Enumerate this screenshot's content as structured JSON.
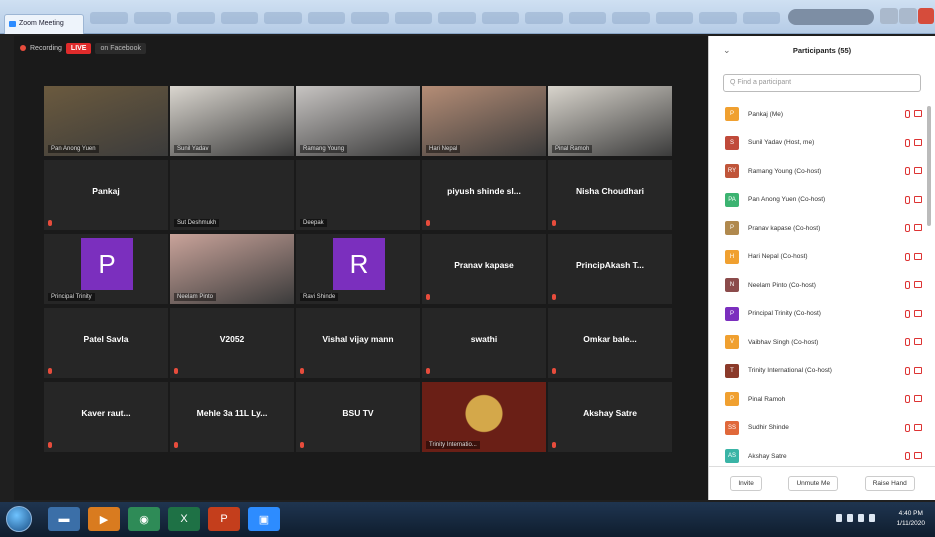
{
  "window": {
    "tab_title": "Zoom Meeting"
  },
  "meeting": {
    "recording_label": "Recording",
    "live_label": "LIVE",
    "view_label": "on Facebook",
    "tiles": [
      [
        {
          "kind": "video",
          "caption": "Pan Anong Yuen",
          "photo_color": "#6b5a3e",
          "active": true
        },
        {
          "kind": "video",
          "caption": "Sunil Yadav",
          "photo_color": "#dad6cf"
        },
        {
          "kind": "video",
          "caption": "Ramang Young",
          "photo_color": "#c7c4c2"
        },
        {
          "kind": "video",
          "caption": "Hari Nepal",
          "photo_color": "#b58d76"
        },
        {
          "kind": "video",
          "caption": "Pinal Ramoh",
          "photo_color": "#d8d4cc"
        }
      ],
      [
        {
          "kind": "name",
          "name": "Pankaj"
        },
        {
          "kind": "blank",
          "caption": "Sut Deshmukh"
        },
        {
          "kind": "blank",
          "caption": "Deepak"
        },
        {
          "kind": "name",
          "name": "piyush shinde sl..."
        },
        {
          "kind": "name",
          "name": "Nisha Choudhari"
        }
      ],
      [
        {
          "kind": "letter",
          "letter": "P",
          "caption": "Principal Trinity"
        },
        {
          "kind": "video",
          "caption": "Neelam Pinto",
          "photo_color": "#c9a39a"
        },
        {
          "kind": "letter",
          "letter": "R",
          "caption": "Ravi Shinde"
        },
        {
          "kind": "name",
          "name": "Pranav kapase"
        },
        {
          "kind": "name",
          "name": "PrincipAkash T..."
        }
      ],
      [
        {
          "kind": "name",
          "name": "Patel Savla"
        },
        {
          "kind": "name",
          "name": "V2052"
        },
        {
          "kind": "name",
          "name": "Vishal vijay mann"
        },
        {
          "kind": "name",
          "name": "swathi"
        },
        {
          "kind": "name",
          "name": "Omkar bale..."
        }
      ],
      [
        {
          "kind": "name",
          "name": "Kaver raut..."
        },
        {
          "kind": "name",
          "name": "Mehle 3a 11L Ly..."
        },
        {
          "kind": "name",
          "name": "BSU TV"
        },
        {
          "kind": "video",
          "caption": "Trinity Internatio...",
          "photo_color": "#6a1f16",
          "emblem": true
        },
        {
          "kind": "name",
          "name": "Akshay Satre"
        }
      ]
    ]
  },
  "participants": {
    "title": "Participants (55)",
    "collapse": "⌄",
    "search_placeholder": "Q  Find a participant",
    "items": [
      {
        "name": "Pankaj (Me)",
        "color": "#f0a030",
        "initial": "P"
      },
      {
        "name": "Sunil Yadav (Host, me)",
        "color": "#c04a3a",
        "initial": "S"
      },
      {
        "name": "Ramang Young (Co-host)",
        "color": "#c0553a",
        "initial": "RY"
      },
      {
        "name": "Pan Anong Yuen (Co-host)",
        "color": "#3cb371",
        "initial": "PA"
      },
      {
        "name": "Pranav kapase (Co-host)",
        "color": "#b0894e",
        "initial": "P"
      },
      {
        "name": "Hari Nepal (Co-host)",
        "color": "#f0a030",
        "initial": "H"
      },
      {
        "name": "Neelam Pinto (Co-host)",
        "color": "#8b4b4b",
        "initial": "N"
      },
      {
        "name": "Principal Trinity (Co-host)",
        "color": "#7b2fbe",
        "initial": "P"
      },
      {
        "name": "Vaibhav Singh (Co-host)",
        "color": "#f0a030",
        "initial": "V"
      },
      {
        "name": "Trinity International (Co-host)",
        "color": "#8b3a2a",
        "initial": "T"
      },
      {
        "name": "Pinal Ramoh",
        "color": "#f0a030",
        "initial": "P"
      },
      {
        "name": "Sudhir Shinde",
        "color": "#e0683a",
        "initial": "SS"
      },
      {
        "name": "Akshay Satre",
        "color": "#3ab4a6",
        "initial": "AS"
      }
    ],
    "footer": {
      "invite": "Invite",
      "unmute_me": "Unmute Me",
      "raise_hand": "Raise Hand"
    }
  },
  "taskbar": {
    "apps": [
      {
        "icon": "folder-icon",
        "color": "#3b6fa8",
        "glyph": "▬"
      },
      {
        "icon": "media-player-icon",
        "color": "#d97b1f",
        "glyph": "▶"
      },
      {
        "icon": "chrome-icon",
        "color": "#2e8b57",
        "glyph": "◉"
      },
      {
        "icon": "excel-icon",
        "color": "#1e7145",
        "glyph": "X"
      },
      {
        "icon": "powerpoint-icon",
        "color": "#c43e1c",
        "glyph": "P"
      },
      {
        "icon": "zoom-icon",
        "color": "#2d8cff",
        "glyph": "▣"
      }
    ],
    "time": "4:40 PM",
    "date": "1/11/2020"
  }
}
